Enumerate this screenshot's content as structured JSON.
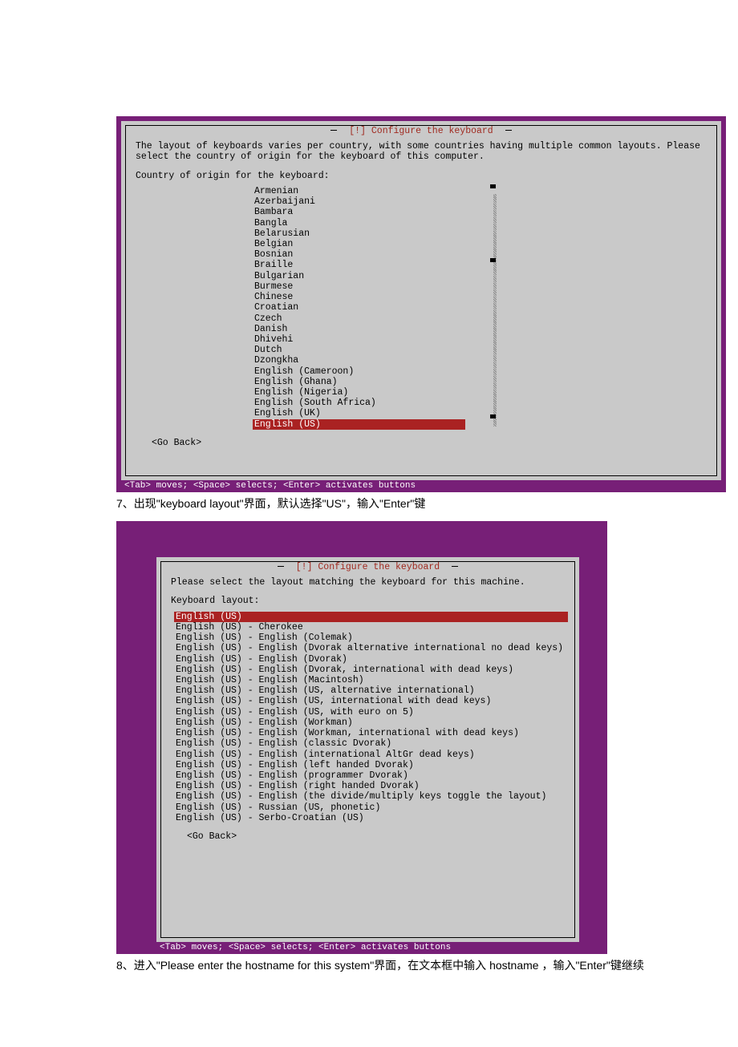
{
  "screen1": {
    "title": "[!] Configure the keyboard",
    "desc": "The layout of keyboards varies per country, with some countries having multiple common layouts. Please select the country of origin for the keyboard of this computer.",
    "label": "Country of origin for the keyboard:",
    "items": [
      "Armenian",
      "Azerbaijani",
      "Bambara",
      "Bangla",
      "Belarusian",
      "Belgian",
      "Bosnian",
      "Braille",
      "Bulgarian",
      "Burmese",
      "Chinese",
      "Croatian",
      "Czech",
      "Danish",
      "Dhivehi",
      "Dutch",
      "Dzongkha",
      "English (Cameroon)",
      "English (Ghana)",
      "English (Nigeria)",
      "English (South Africa)",
      "English (UK)"
    ],
    "selected": "English (US)",
    "go_back": "<Go Back>",
    "status": "<Tab> moves; <Space> selects; <Enter> activates buttons"
  },
  "instr1": "7、出现\"keyboard layout\"界面，默认选择\"US\"，输入\"Enter\"键",
  "screen2": {
    "title": "[!] Configure the keyboard",
    "desc": "Please select the layout matching the keyboard for this machine.",
    "label": "Keyboard layout:",
    "selected": "English (US)",
    "items": [
      "English (US) - Cherokee",
      "English (US) - English (Colemak)",
      "English (US) - English (Dvorak alternative international no dead keys)",
      "English (US) - English (Dvorak)",
      "English (US) - English (Dvorak, international with dead keys)",
      "English (US) - English (Macintosh)",
      "English (US) - English (US, alternative international)",
      "English (US) - English (US, international with dead keys)",
      "English (US) - English (US, with euro on 5)",
      "English (US) - English (Workman)",
      "English (US) - English (Workman, international with dead keys)",
      "English (US) - English (classic Dvorak)",
      "English (US) - English (international AltGr dead keys)",
      "English (US) - English (left handed Dvorak)",
      "English (US) - English (programmer Dvorak)",
      "English (US) - English (right handed Dvorak)",
      "English (US) - English (the divide/multiply keys toggle the layout)",
      "English (US) - Russian (US, phonetic)",
      "English (US) - Serbo-Croatian (US)"
    ],
    "go_back": "<Go Back>",
    "status": "<Tab> moves; <Space> selects; <Enter> activates buttons"
  },
  "instr2": "8、进入\"Please enter the hostname for this system\"界面，在文本框中输入 hostname ，输入\"Enter\"键继续"
}
